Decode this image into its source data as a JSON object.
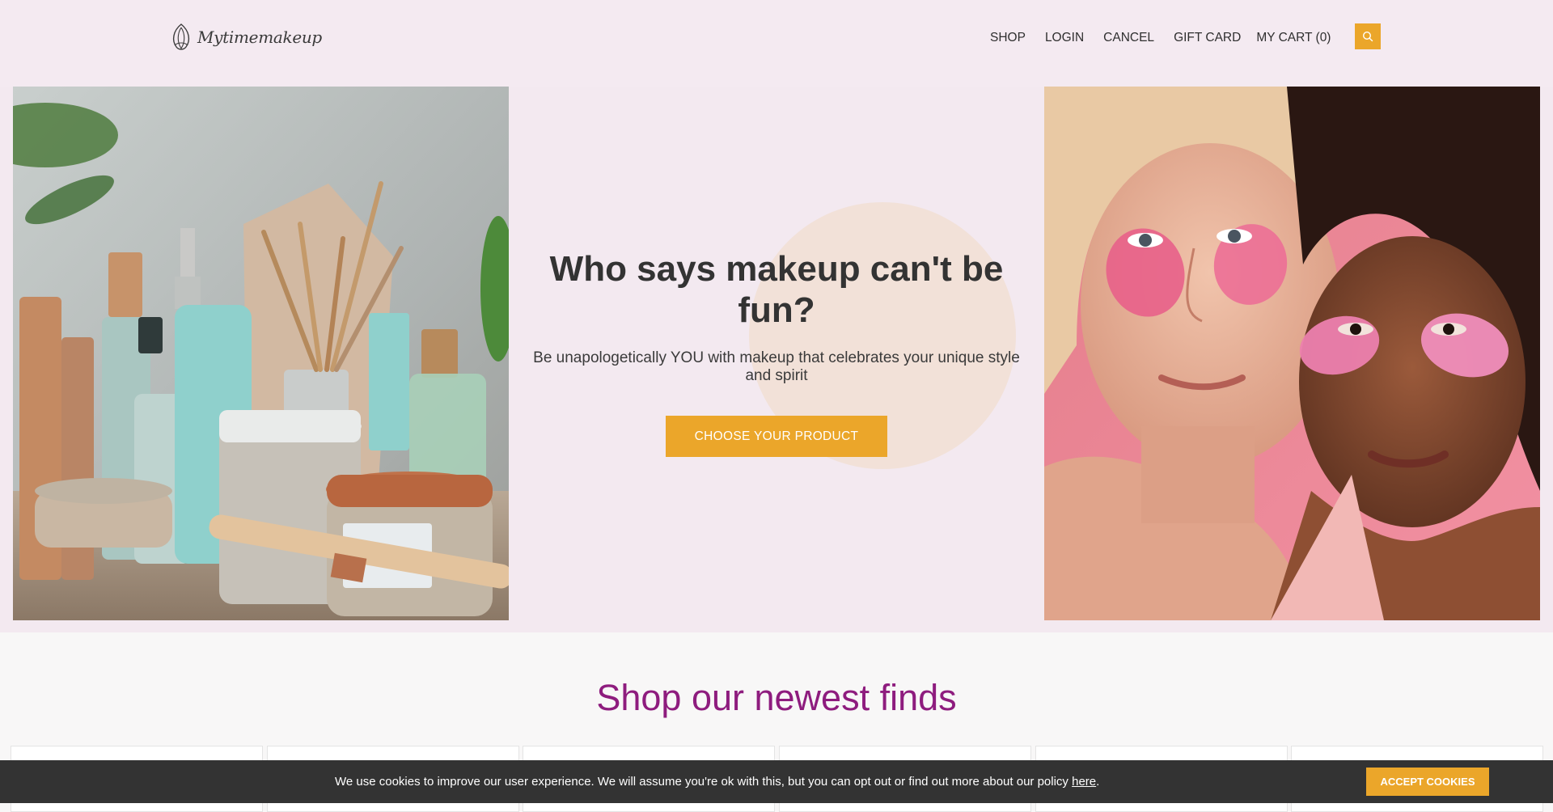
{
  "brand": {
    "name": "Mytimemakeup"
  },
  "nav": {
    "items": [
      {
        "label": "SHOP"
      },
      {
        "label": "LOGIN"
      },
      {
        "label": "CANCEL"
      },
      {
        "label": "GIFT CARD"
      },
      {
        "label": "MY CART (0)"
      }
    ],
    "search_icon": "search-icon"
  },
  "hero": {
    "title": "Who says makeup can't be fun?",
    "subtitle": "Be unapologetically YOU with makeup that celebrates your unique style and spirit",
    "cta_label": "CHOOSE YOUR PRODUCT",
    "left_image": "skincare-products-with-brushes",
    "right_image": "two-women-with-under-eye-patches"
  },
  "shop": {
    "title": "Shop our newest finds"
  },
  "cookie": {
    "text_before": "We use cookies to improve our user experience. We will assume you're ok with this, but you can opt out or find out more about our policy ",
    "link_label": "here",
    "text_after": ".",
    "accept_label": "ACCEPT COOKIES"
  },
  "colors": {
    "accent": "#eba62a",
    "header_bg": "#f4eaf1",
    "hero_bg": "#f3e9f0",
    "shop_title": "#8e1c7e",
    "cookie_bg": "#333333"
  }
}
